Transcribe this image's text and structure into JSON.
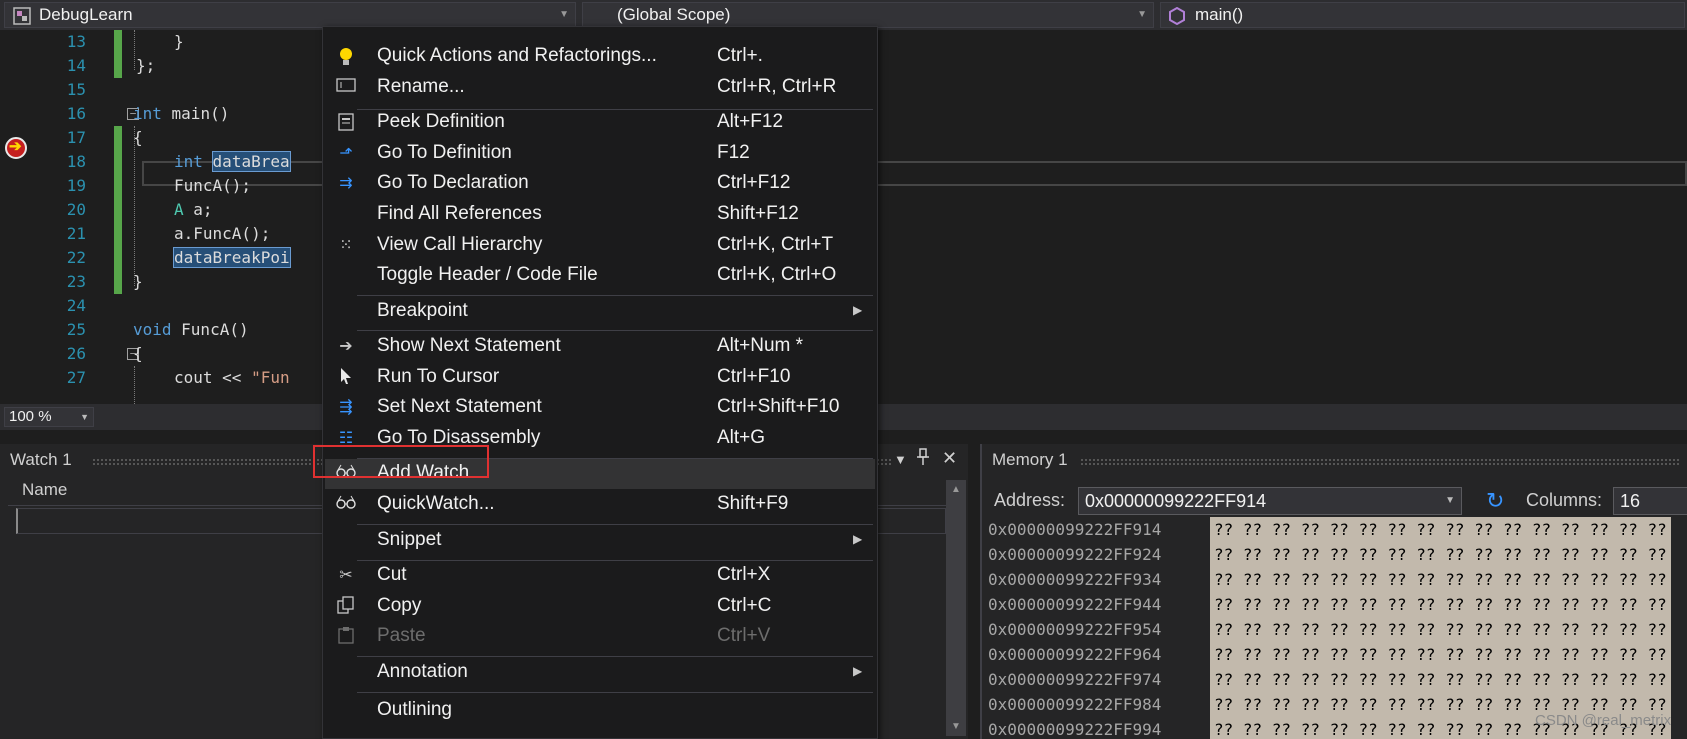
{
  "nav": {
    "project": "DebugLearn",
    "scope": "(Global Scope)",
    "member": "main()"
  },
  "editor": {
    "line_numbers": [
      "13",
      "14",
      "15",
      "16",
      "17",
      "18",
      "19",
      "20",
      "21",
      "22",
      "23",
      "24",
      "25",
      "26",
      "27"
    ],
    "lines": {
      "l13": "}",
      "l14": "};",
      "l16_kw": "int",
      "l16_rest": " main()",
      "l17": "{",
      "l18_kw": "int",
      "l18_sel": "dataBrea",
      "l19": "FuncA();",
      "l20_type": "A",
      "l20_rest": " a;",
      "l21": "a.FuncA();",
      "l22_sel": "dataBreakPoi",
      "l23": "}",
      "l25_kw": "void",
      "l25_rest": " FuncA()",
      "l26": "{",
      "l27_pre": "cout << ",
      "l27_str": "\"Fun"
    },
    "zoom": "100 %"
  },
  "watch": {
    "title": "Watch 1",
    "column_name": "Name"
  },
  "memory": {
    "title": "Memory 1",
    "address_label": "Address:",
    "address_value": "0x00000099222FF914",
    "columns_label": "Columns:",
    "columns_value": "16",
    "rows": [
      {
        "addr": "0x00000099222FF914",
        "bytes": "?? ?? ?? ?? ?? ?? ?? ?? ?? ?? ?? ?? ?? ?? ?? ??"
      },
      {
        "addr": "0x00000099222FF924",
        "bytes": "?? ?? ?? ?? ?? ?? ?? ?? ?? ?? ?? ?? ?? ?? ?? ??"
      },
      {
        "addr": "0x00000099222FF934",
        "bytes": "?? ?? ?? ?? ?? ?? ?? ?? ?? ?? ?? ?? ?? ?? ?? ??"
      },
      {
        "addr": "0x00000099222FF944",
        "bytes": "?? ?? ?? ?? ?? ?? ?? ?? ?? ?? ?? ?? ?? ?? ?? ??"
      },
      {
        "addr": "0x00000099222FF954",
        "bytes": "?? ?? ?? ?? ?? ?? ?? ?? ?? ?? ?? ?? ?? ?? ?? ??"
      },
      {
        "addr": "0x00000099222FF964",
        "bytes": "?? ?? ?? ?? ?? ?? ?? ?? ?? ?? ?? ?? ?? ?? ?? ??"
      },
      {
        "addr": "0x00000099222FF974",
        "bytes": "?? ?? ?? ?? ?? ?? ?? ?? ?? ?? ?? ?? ?? ?? ?? ??"
      },
      {
        "addr": "0x00000099222FF984",
        "bytes": "?? ?? ?? ?? ?? ?? ?? ?? ?? ?? ?? ?? ?? ?? ?? ??"
      },
      {
        "addr": "0x00000099222FF994",
        "bytes": "?? ?? ?? ?? ?? ?? ?? ?? ?? ?? ?? ?? ?? ?? ?? ??"
      }
    ]
  },
  "context_menu": {
    "items": [
      {
        "label": "Quick Actions and Refactorings...",
        "shortcut": "Ctrl+.",
        "icon": "lightbulb-icon"
      },
      {
        "label": "Rename...",
        "shortcut": "Ctrl+R, Ctrl+R",
        "icon": "rename-icon"
      },
      {
        "label": "Peek Definition",
        "shortcut": "Alt+F12",
        "icon": "peek-definition-icon"
      },
      {
        "label": "Go To Definition",
        "shortcut": "F12",
        "icon": "go-to-definition-icon"
      },
      {
        "label": "Go To Declaration",
        "shortcut": "Ctrl+F12",
        "icon": "go-to-declaration-icon"
      },
      {
        "label": "Find All References",
        "shortcut": "Shift+F12",
        "icon": ""
      },
      {
        "label": "View Call Hierarchy",
        "shortcut": "Ctrl+K, Ctrl+T",
        "icon": "call-hierarchy-icon"
      },
      {
        "label": "Toggle Header / Code File",
        "shortcut": "Ctrl+K, Ctrl+O",
        "icon": ""
      },
      {
        "label": "Breakpoint",
        "shortcut": "",
        "icon": ""
      },
      {
        "label": "Show Next Statement",
        "shortcut": "Alt+Num *",
        "icon": "arrow-right-icon"
      },
      {
        "label": "Run To Cursor",
        "shortcut": "Ctrl+F10",
        "icon": "cursor-icon"
      },
      {
        "label": "Set Next Statement",
        "shortcut": "Ctrl+Shift+F10",
        "icon": "set-next-statement-icon"
      },
      {
        "label": "Go To Disassembly",
        "shortcut": "Alt+G",
        "icon": "disassembly-icon"
      },
      {
        "label": "Add Watch",
        "shortcut": "",
        "icon": "glasses-icon"
      },
      {
        "label": "QuickWatch...",
        "shortcut": "Shift+F9",
        "icon": "glasses-icon"
      },
      {
        "label": "Snippet",
        "shortcut": "",
        "icon": ""
      },
      {
        "label": "Cut",
        "shortcut": "Ctrl+X",
        "icon": "scissors-icon"
      },
      {
        "label": "Copy",
        "shortcut": "Ctrl+C",
        "icon": "copy-icon"
      },
      {
        "label": "Paste",
        "shortcut": "Ctrl+V",
        "icon": "paste-icon"
      },
      {
        "label": "Annotation",
        "shortcut": "",
        "icon": ""
      },
      {
        "label": "Outlining",
        "shortcut": "",
        "icon": ""
      }
    ]
  },
  "watermark": "CSDN @real_metrix",
  "colors": {
    "accent": "#3794ff",
    "highlight_box": "#e03131",
    "change_bar": "#57a64a",
    "selection": "#264f78"
  }
}
